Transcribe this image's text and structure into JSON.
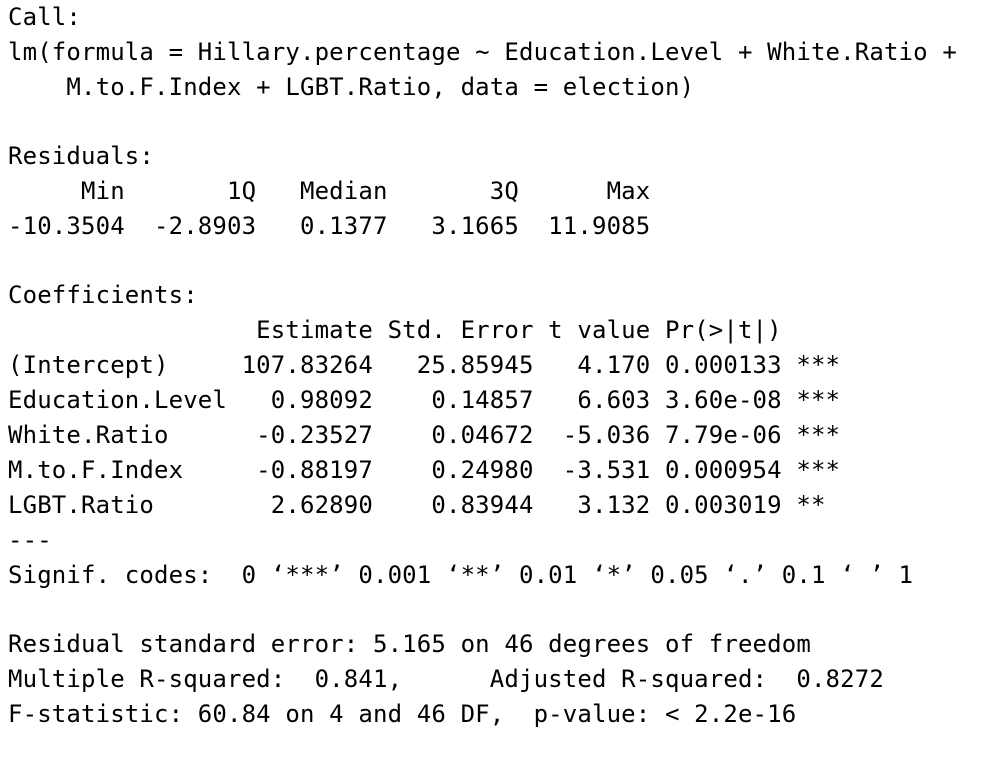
{
  "call": {
    "header": "Call:",
    "line1": "lm(formula = Hillary.percentage ~ Education.Level + White.Ratio +",
    "line2": "    M.to.F.Index + LGBT.Ratio, data = election)"
  },
  "residuals": {
    "header": "Residuals:",
    "columns_line": "     Min       1Q   Median       3Q      Max",
    "values_line": "-10.3504  -2.8903   0.1377   3.1665  11.9085",
    "columns": [
      "Min",
      "1Q",
      "Median",
      "3Q",
      "Max"
    ],
    "values": [
      "-10.3504",
      "-2.8903",
      "0.1377",
      "3.1665",
      "11.9085"
    ]
  },
  "coefficients": {
    "header": "Coefficients:",
    "header_line": "                 Estimate Std. Error t value Pr(>|t|)    ",
    "column_names": [
      "Estimate",
      "Std. Error",
      "t value",
      "Pr(>|t|)"
    ],
    "rows": [
      {
        "line": "(Intercept)     107.83264   25.85945   4.170 0.000133 ***",
        "term": "(Intercept)",
        "estimate": "107.83264",
        "std_error": "25.85945",
        "t_value": "4.170",
        "p_value": "0.000133",
        "signif": "***"
      },
      {
        "line": "Education.Level   0.98092    0.14857   6.603 3.60e-08 ***",
        "term": "Education.Level",
        "estimate": "0.98092",
        "std_error": "0.14857",
        "t_value": "6.603",
        "p_value": "3.60e-08",
        "signif": "***"
      },
      {
        "line": "White.Ratio      -0.23527    0.04672  -5.036 7.79e-06 ***",
        "term": "White.Ratio",
        "estimate": "-0.23527",
        "std_error": "0.04672",
        "t_value": "-5.036",
        "p_value": "7.79e-06",
        "signif": "***"
      },
      {
        "line": "M.to.F.Index     -0.88197    0.24980  -3.531 0.000954 ***",
        "term": "M.to.F.Index",
        "estimate": "-0.88197",
        "std_error": "0.24980",
        "t_value": "-3.531",
        "p_value": "0.000954",
        "signif": "***"
      },
      {
        "line": "LGBT.Ratio        2.62890    0.83944   3.132 0.003019 ** ",
        "term": "LGBT.Ratio",
        "estimate": "2.62890",
        "std_error": "0.83944",
        "t_value": "3.132",
        "p_value": "0.003019",
        "signif": "**"
      }
    ],
    "separator": "---",
    "signif_codes": "Signif. codes:  0 ‘***’ 0.001 ‘**’ 0.01 ‘*’ 0.05 ‘.’ 0.1 ‘ ’ 1"
  },
  "summary": {
    "residual_se": "Residual standard error: 5.165 on 46 degrees of freedom",
    "r_squared": "Multiple R-squared:  0.841,\tAdjusted R-squared:  0.8272 ",
    "f_statistic": "F-statistic: 60.84 on 4 and 46 DF,  p-value: < 2.2e-16"
  }
}
